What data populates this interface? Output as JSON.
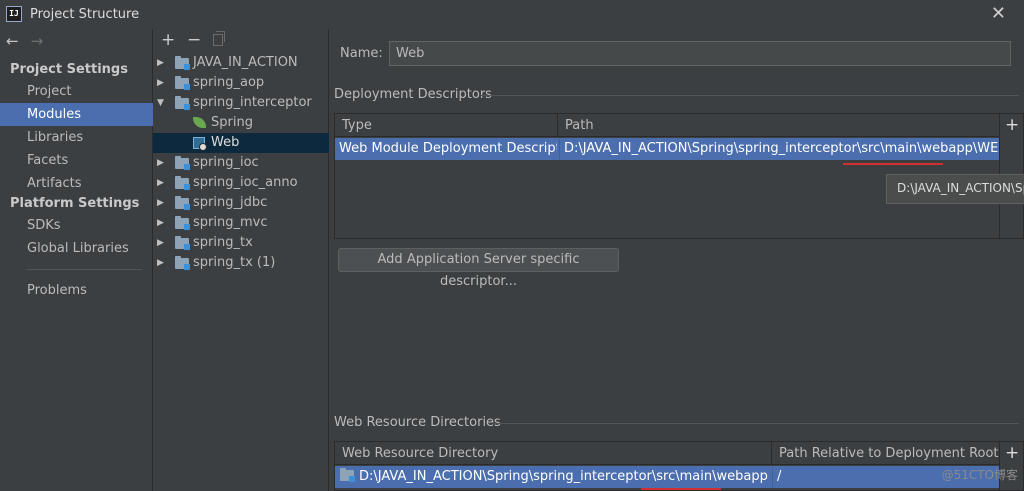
{
  "window": {
    "title": "Project Structure",
    "app_icon": "IJ"
  },
  "left_nav": {
    "project_settings_header": "Project Settings",
    "project_items": [
      "Project",
      "Modules",
      "Libraries",
      "Facets",
      "Artifacts"
    ],
    "platform_settings_header": "Platform Settings",
    "platform_items": [
      "SDKs",
      "Global Libraries"
    ],
    "problems": "Problems",
    "selected": "Modules"
  },
  "tree": {
    "items": [
      {
        "label": "JAVA_IN_ACTION",
        "type": "module",
        "expanded": false
      },
      {
        "label": "spring_aop",
        "type": "module",
        "expanded": false
      },
      {
        "label": "spring_interceptor",
        "type": "module",
        "expanded": true
      },
      {
        "label": "Spring",
        "type": "facet-spring"
      },
      {
        "label": "Web",
        "type": "facet-web",
        "selected": true
      },
      {
        "label": "spring_ioc",
        "type": "module",
        "expanded": false
      },
      {
        "label": "spring_ioc_anno",
        "type": "module",
        "expanded": false
      },
      {
        "label": "spring_jdbc",
        "type": "module",
        "expanded": false
      },
      {
        "label": "spring_mvc",
        "type": "module",
        "expanded": false
      },
      {
        "label": "spring_tx",
        "type": "module",
        "expanded": false
      },
      {
        "label": "spring_tx (1)",
        "type": "module",
        "expanded": false
      }
    ]
  },
  "facet": {
    "name_label": "Name:",
    "name_value": "Web",
    "deployment_descriptors": {
      "title": "Deployment Descriptors",
      "columns": [
        "Type",
        "Path"
      ],
      "rows": [
        [
          "Web Module Deployment Descriptor",
          "D:\\JAVA_IN_ACTION\\Spring\\spring_interceptor\\src\\main\\webapp\\WEB-INF\\web.xml"
        ]
      ],
      "tooltip": "D:\\JAVA_IN_ACTION\\Spring\\spring_interceptor\\src\\main\\webapp\\WEB-INF\\web.xml",
      "add_button": "Add Application Server specific descriptor..."
    },
    "web_resource_directories": {
      "title": "Web Resource Directories",
      "columns": [
        "Web Resource Directory",
        "Path Relative to Deployment Root"
      ],
      "rows": [
        [
          "D:\\JAVA_IN_ACTION\\Spring\\spring_interceptor\\src\\main\\webapp",
          "/"
        ]
      ]
    }
  },
  "watermark": "@51CTO博客",
  "colors": {
    "background": "#3c3f41",
    "selection": "#4b6eaf",
    "tree_selection": "#0d293e",
    "highlight_underline": "#d23030"
  }
}
